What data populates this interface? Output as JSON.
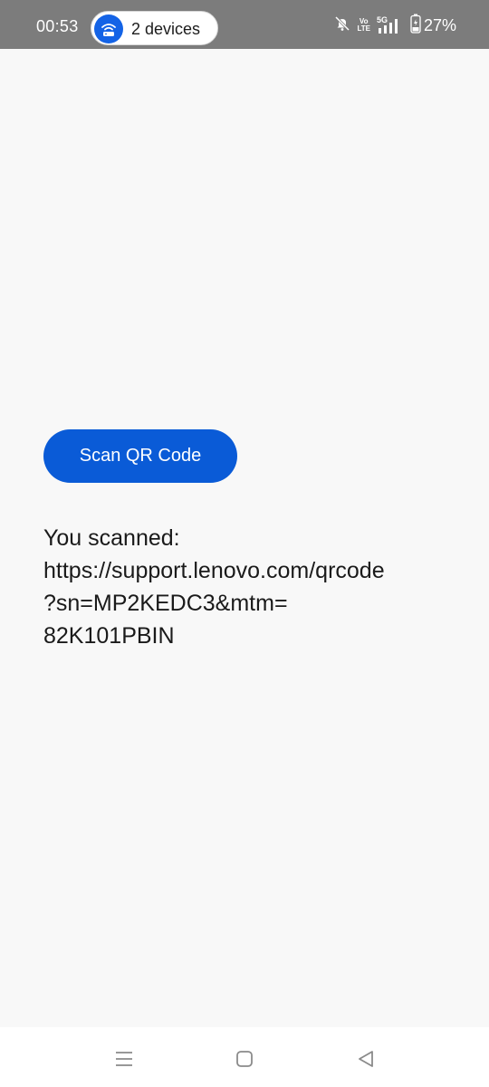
{
  "status_bar": {
    "time": "00:53",
    "hotspot_label": "2 devices",
    "network_volte_top": "Vo",
    "network_volte_bottom": "LTE",
    "network_type": "5G",
    "battery_percent": "27%",
    "icons": [
      "hotspot-icon",
      "mute-bell-icon",
      "volte-icon",
      "signal-5g-icon",
      "battery-icon"
    ]
  },
  "main": {
    "scan_button_label": "Scan QR Code",
    "result_lines": [
      "You scanned:",
      "https://support.lenovo.com/qrcode",
      "?sn=MP2KEDC3&mtm=",
      "82K101PBIN"
    ]
  },
  "nav_bar": {
    "icons": [
      "recent-apps-icon",
      "home-icon",
      "back-icon"
    ]
  },
  "colors": {
    "accent": "#0a5bd7",
    "status_bar_bg": "#7c7c7c",
    "page_bg": "#f8f8f8"
  }
}
